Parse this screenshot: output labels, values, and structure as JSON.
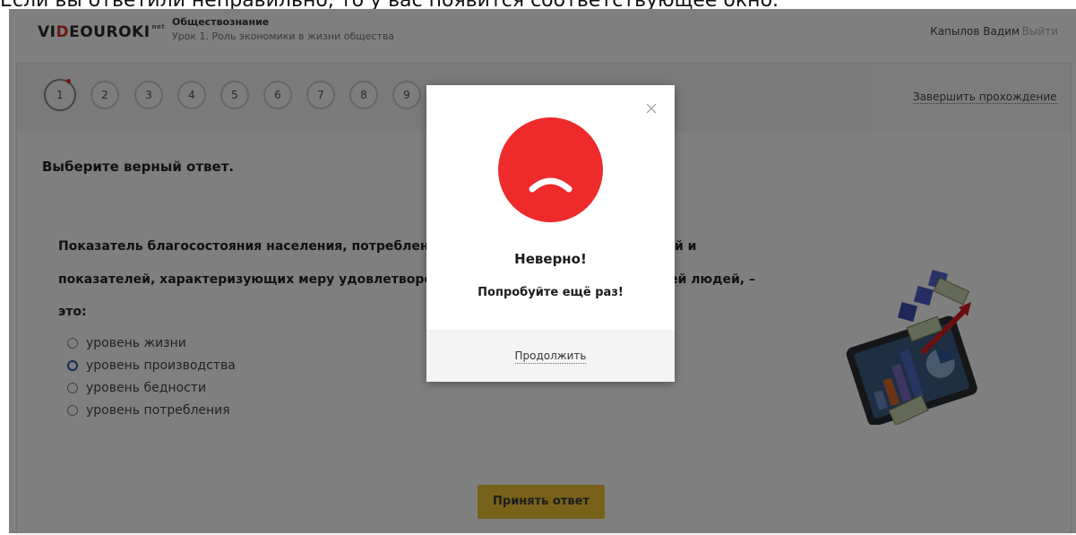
{
  "caption": "Если вы ответили неправильно, то у вас появится соответствующее окно.",
  "header": {
    "logo_main": "VIDEOUROKI",
    "logo_sup": "net",
    "subject": "Обществознание",
    "lesson": "Урок 1. Роль экономики в жизни общества",
    "user": "Капылов Вадим",
    "logout": "Выйти"
  },
  "progress": {
    "steps": [
      "1",
      "2",
      "3",
      "4",
      "5",
      "6",
      "7",
      "8",
      "9"
    ],
    "current": "1",
    "finish": "Завершить прохождение"
  },
  "question": {
    "instruction": "Выберите верный ответ.",
    "line1": "Показатель благосостояния населения, потребления",
    "line1_tail": "й и",
    "line2": "показателей, характеризующих меру удовлетворени",
    "line2_tail": "тей людей, –",
    "line3": "это:",
    "options": [
      "уровень жизни",
      "уровень производства",
      "уровень бедности",
      "уровень потребления"
    ],
    "selected_index": 1,
    "submit": "Принять ответ"
  },
  "modal": {
    "title": "Неверно!",
    "subtitle": "Попробуйте ещё раз!",
    "continue": "Продолжить",
    "face_color": "#ee2a2b"
  }
}
